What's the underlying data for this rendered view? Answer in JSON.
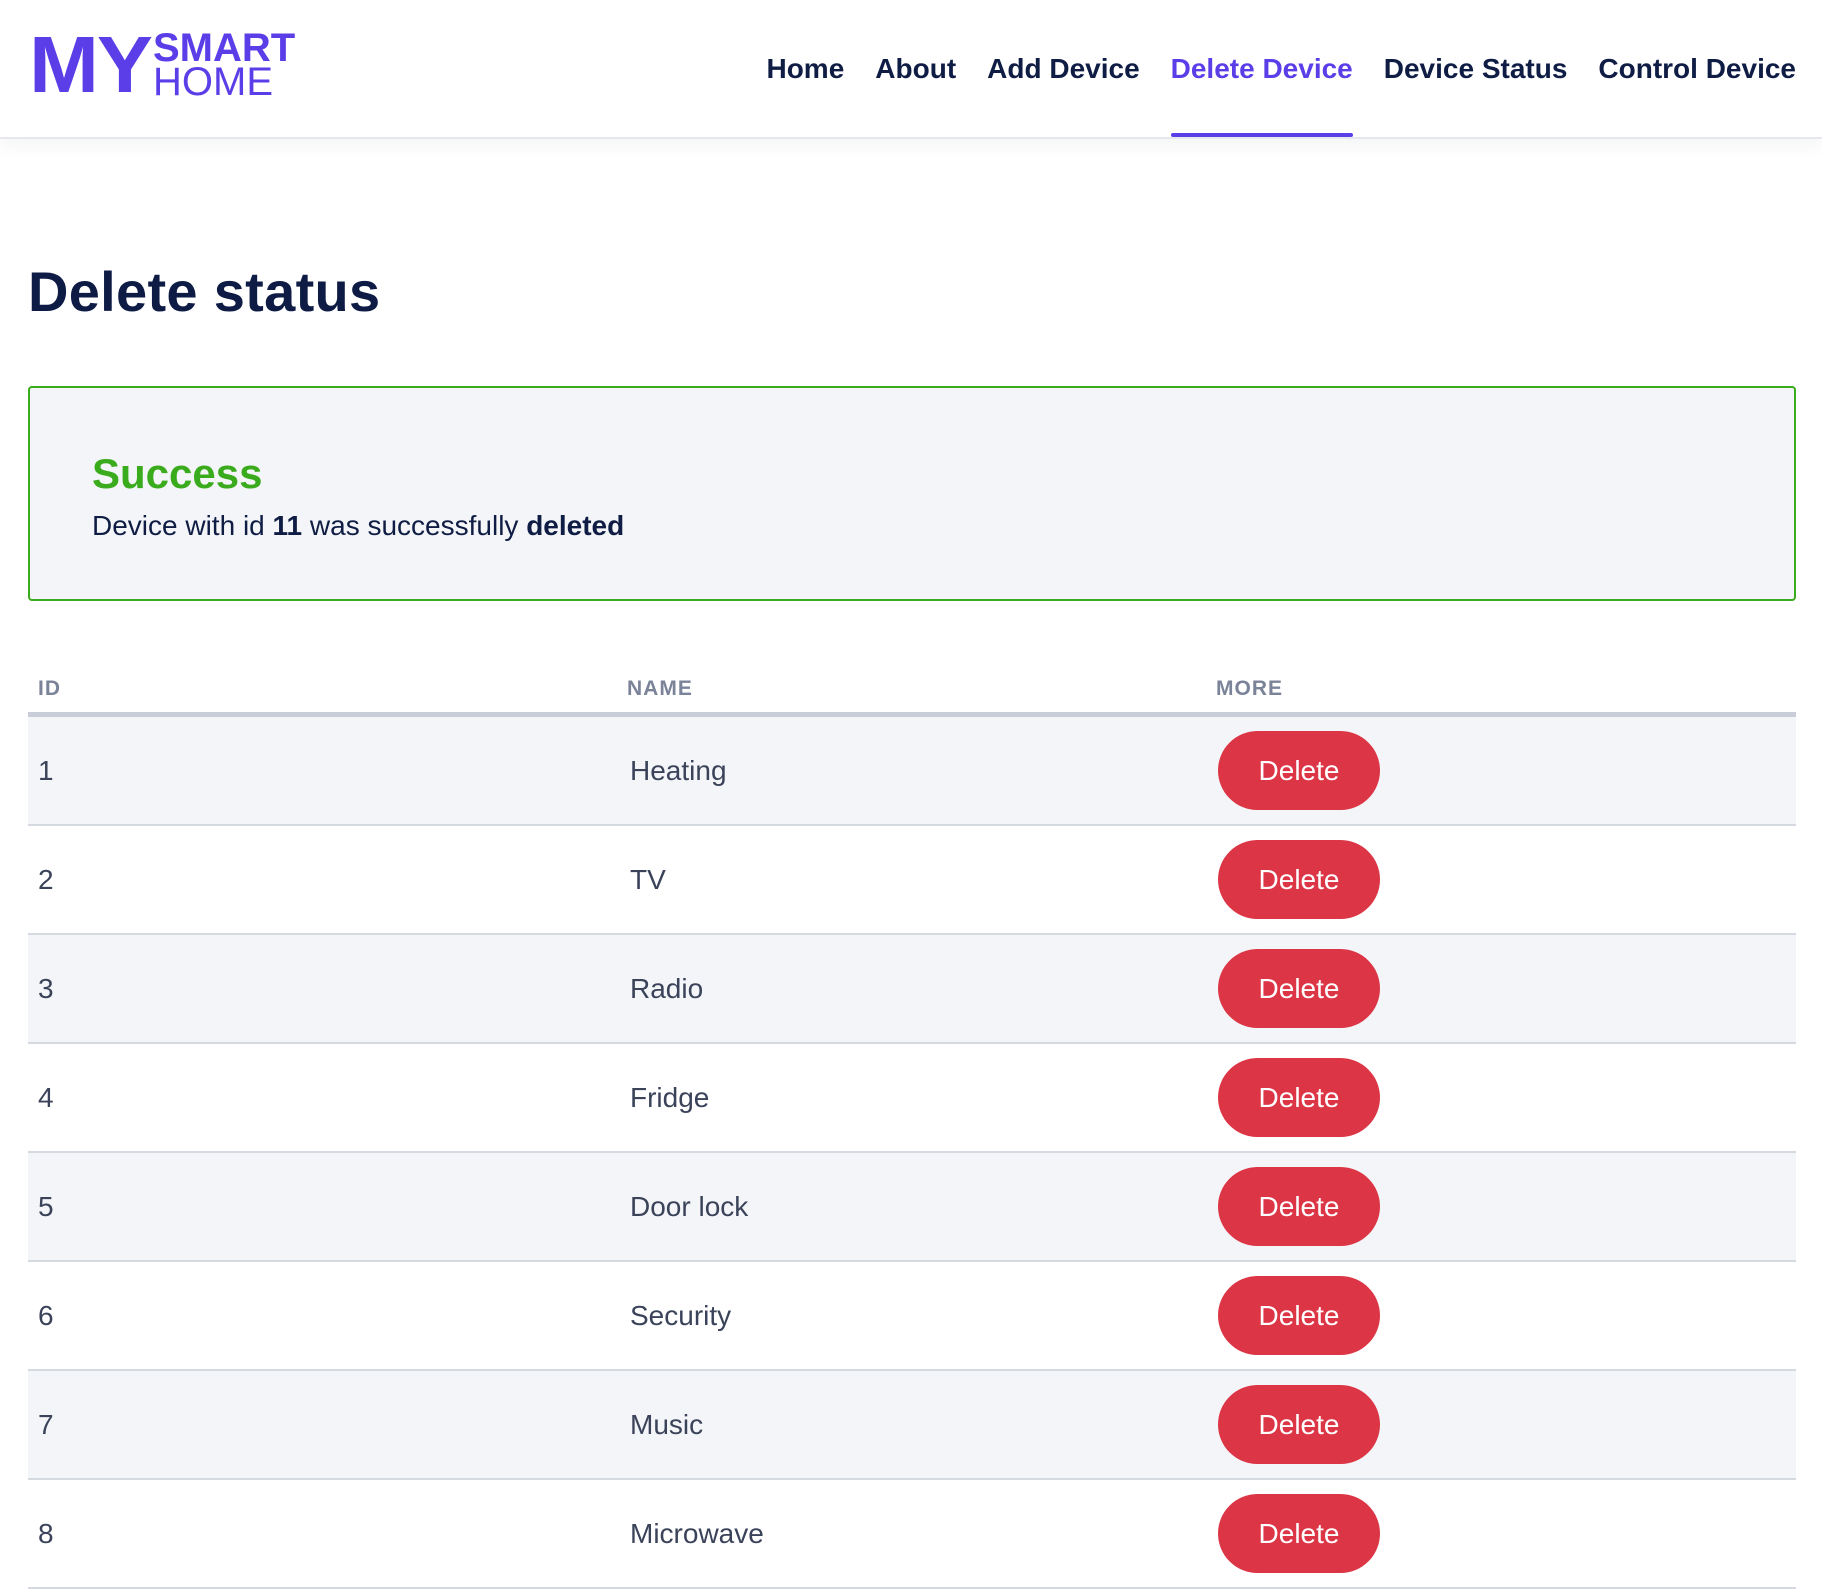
{
  "logo": {
    "my": "MY",
    "smart": "SMART",
    "home": "HOME"
  },
  "nav": {
    "items": [
      {
        "label": "Home"
      },
      {
        "label": "About"
      },
      {
        "label": "Add Device"
      },
      {
        "label": "Delete Device",
        "active": true
      },
      {
        "label": "Device Status"
      },
      {
        "label": "Control Device"
      }
    ]
  },
  "page": {
    "title": "Delete status"
  },
  "alert": {
    "title": "Success",
    "message_prefix": "Device with id",
    "device_id": "11",
    "message_middle": "was successfully",
    "message_action": "deleted"
  },
  "table": {
    "headers": {
      "id": "ID",
      "name": "NAME",
      "more": "MORE"
    },
    "rows": [
      {
        "id": "1",
        "name": "Heating",
        "action": "Delete"
      },
      {
        "id": "2",
        "name": "TV",
        "action": "Delete"
      },
      {
        "id": "3",
        "name": "Radio",
        "action": "Delete"
      },
      {
        "id": "4",
        "name": "Fridge",
        "action": "Delete"
      },
      {
        "id": "5",
        "name": "Door lock",
        "action": "Delete"
      },
      {
        "id": "6",
        "name": "Security",
        "action": "Delete"
      },
      {
        "id": "7",
        "name": "Music",
        "action": "Delete"
      },
      {
        "id": "8",
        "name": "Microwave",
        "action": "Delete"
      }
    ]
  },
  "colors": {
    "brand": "#5b3ee8",
    "success": "#3bab1e",
    "danger": "#dc3545",
    "heading": "#0d1b45"
  }
}
